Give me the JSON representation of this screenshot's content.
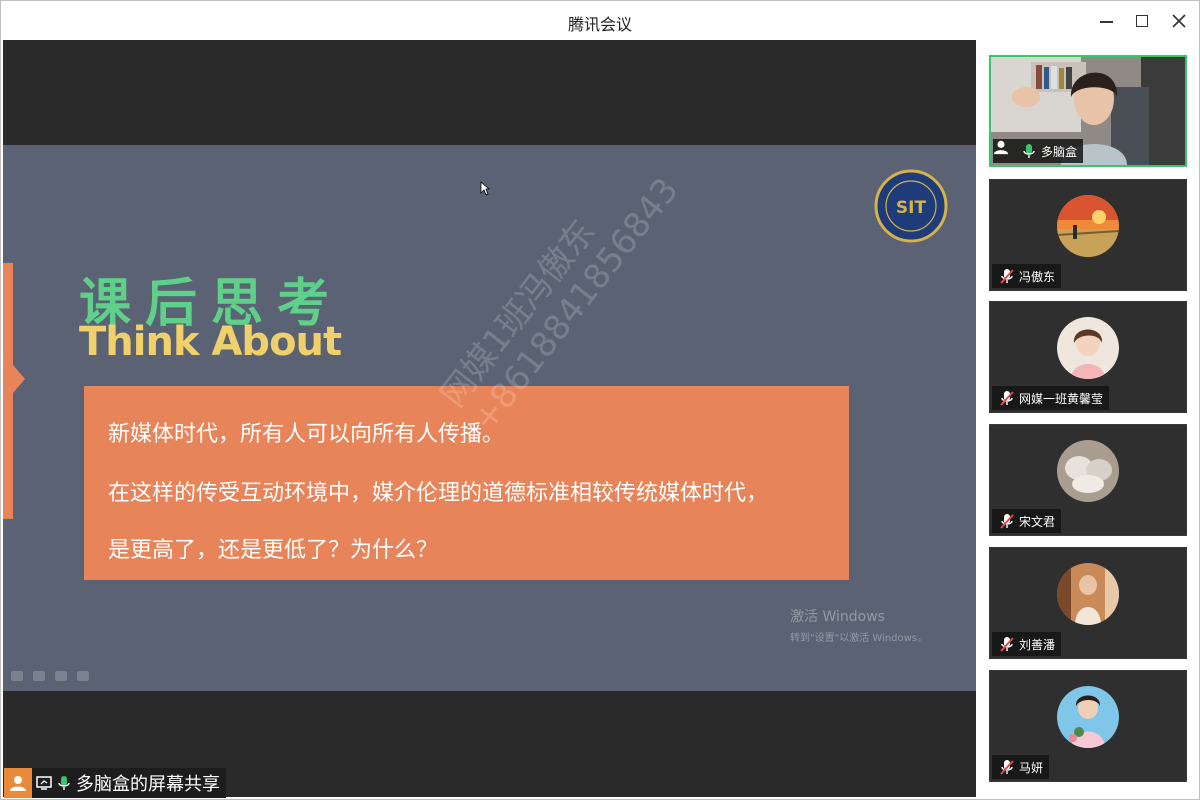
{
  "window": {
    "title": "腾讯会议"
  },
  "slide": {
    "title_cn": "课后思考",
    "title_en": "Think About",
    "line1": "新媒体时代，所有人可以向所有人传播。",
    "line2": "在这样的传受互动环境中，媒介伦理的道德标准相较传统媒体时代，",
    "line3": "是更高了，还是更低了？为什么？",
    "watermark_name": "网媒1班冯傲东",
    "watermark_phone": "+8618841856843",
    "activate_title": "激活 Windows",
    "activate_sub": "转到\"设置\"以激活 Windows。",
    "logo_text": "SIT"
  },
  "share": {
    "label": "多脑盒的屏幕共享"
  },
  "participants": [
    {
      "name": "多脑盒",
      "muted": false,
      "video": true
    },
    {
      "name": "冯傲东",
      "muted": true,
      "video": false
    },
    {
      "name": "网媒一班黄馨莹",
      "muted": true,
      "video": false
    },
    {
      "name": "宋文君",
      "muted": true,
      "video": false
    },
    {
      "name": "刘善潘",
      "muted": true,
      "video": false
    },
    {
      "name": "马妍",
      "muted": true,
      "video": false
    }
  ],
  "colors": {
    "slide_bg": "#5a6273",
    "accent_orange": "#e8845a",
    "title_green": "#5fd08a",
    "title_yellow": "#f0d06a",
    "active_border": "#3cc46c"
  }
}
